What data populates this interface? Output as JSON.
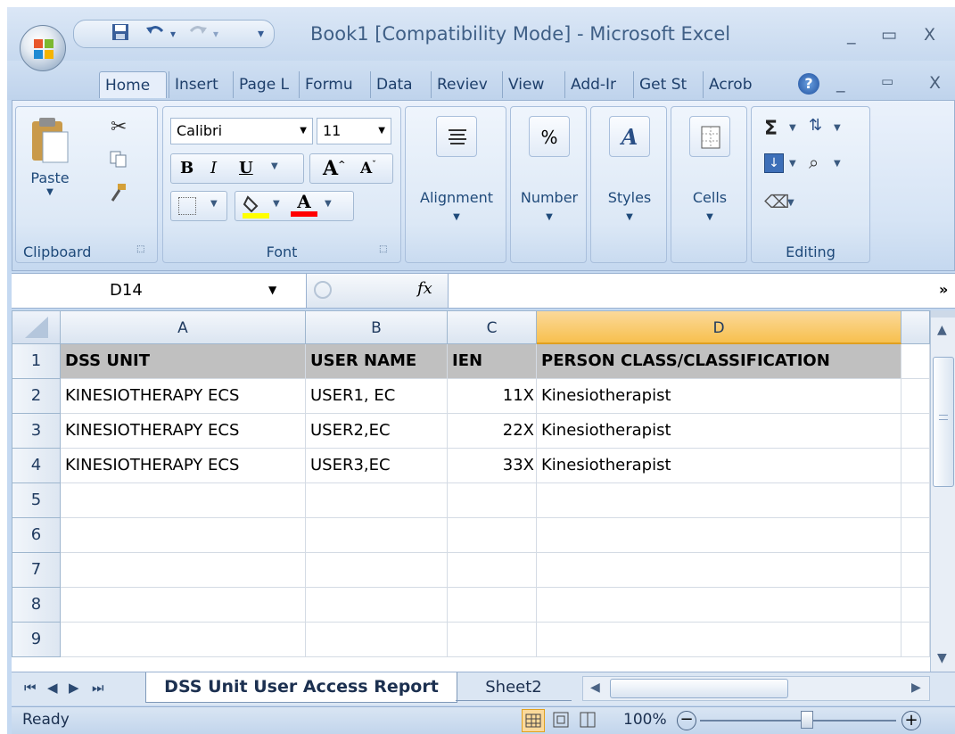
{
  "window": {
    "title": "Book1  [Compatibility Mode] - Microsoft Excel",
    "minimize_glyph": "_",
    "maximize_glyph": "▭",
    "close_glyph": "X"
  },
  "quick_access": {
    "save_icon": "save-icon",
    "undo_icon": "undo-icon",
    "redo_icon": "redo-icon",
    "customize_glyph": "▾"
  },
  "tabs": [
    "Home",
    "Insert",
    "Page L",
    "Formu",
    "Data",
    "Reviev",
    "View",
    "Add-Ir",
    "Get St",
    "Acrob"
  ],
  "ribbon": {
    "clipboard": {
      "label": "Clipboard",
      "paste": "Paste"
    },
    "font": {
      "label": "Font",
      "name": "Calibri",
      "size": "11"
    },
    "alignment": {
      "label": "Alignment"
    },
    "number": {
      "label": "Number",
      "glyph": "%"
    },
    "styles": {
      "label": "Styles"
    },
    "cells": {
      "label": "Cells"
    },
    "editing": {
      "label": "Editing"
    },
    "colors": {
      "highlight": "#ffff00",
      "font_color": "#ff0000"
    }
  },
  "formula_bar": {
    "name_box": "D14",
    "fx": "fx",
    "value": ""
  },
  "columns": [
    "A",
    "B",
    "C",
    "D"
  ],
  "selected_column": "D",
  "rows": [
    {
      "num": "1",
      "a": "DSS UNIT",
      "b": "USER NAME",
      "c": "IEN",
      "d": "PERSON CLASS/CLASSIFICATION",
      "header": true
    },
    {
      "num": "2",
      "a": "KINESIOTHERAPY ECS",
      "b": "USER1, EC",
      "c": "11X",
      "d": "Kinesiotherapist"
    },
    {
      "num": "3",
      "a": "KINESIOTHERAPY ECS",
      "b": "USER2,EC",
      "c": "22X",
      "d": "Kinesiotherapist"
    },
    {
      "num": "4",
      "a": "KINESIOTHERAPY ECS",
      "b": "USER3,EC",
      "c": "33X",
      "d": "Kinesiotherapist"
    },
    {
      "num": "5",
      "a": "",
      "b": "",
      "c": "",
      "d": ""
    },
    {
      "num": "6",
      "a": "",
      "b": "",
      "c": "",
      "d": ""
    },
    {
      "num": "7",
      "a": "",
      "b": "",
      "c": "",
      "d": ""
    },
    {
      "num": "8",
      "a": "",
      "b": "",
      "c": "",
      "d": ""
    },
    {
      "num": "9",
      "a": "",
      "b": "",
      "c": "",
      "d": ""
    }
  ],
  "sheets": [
    "DSS Unit User Access Report",
    "Sheet2"
  ],
  "status": {
    "text": "Ready",
    "zoom": "100%"
  }
}
